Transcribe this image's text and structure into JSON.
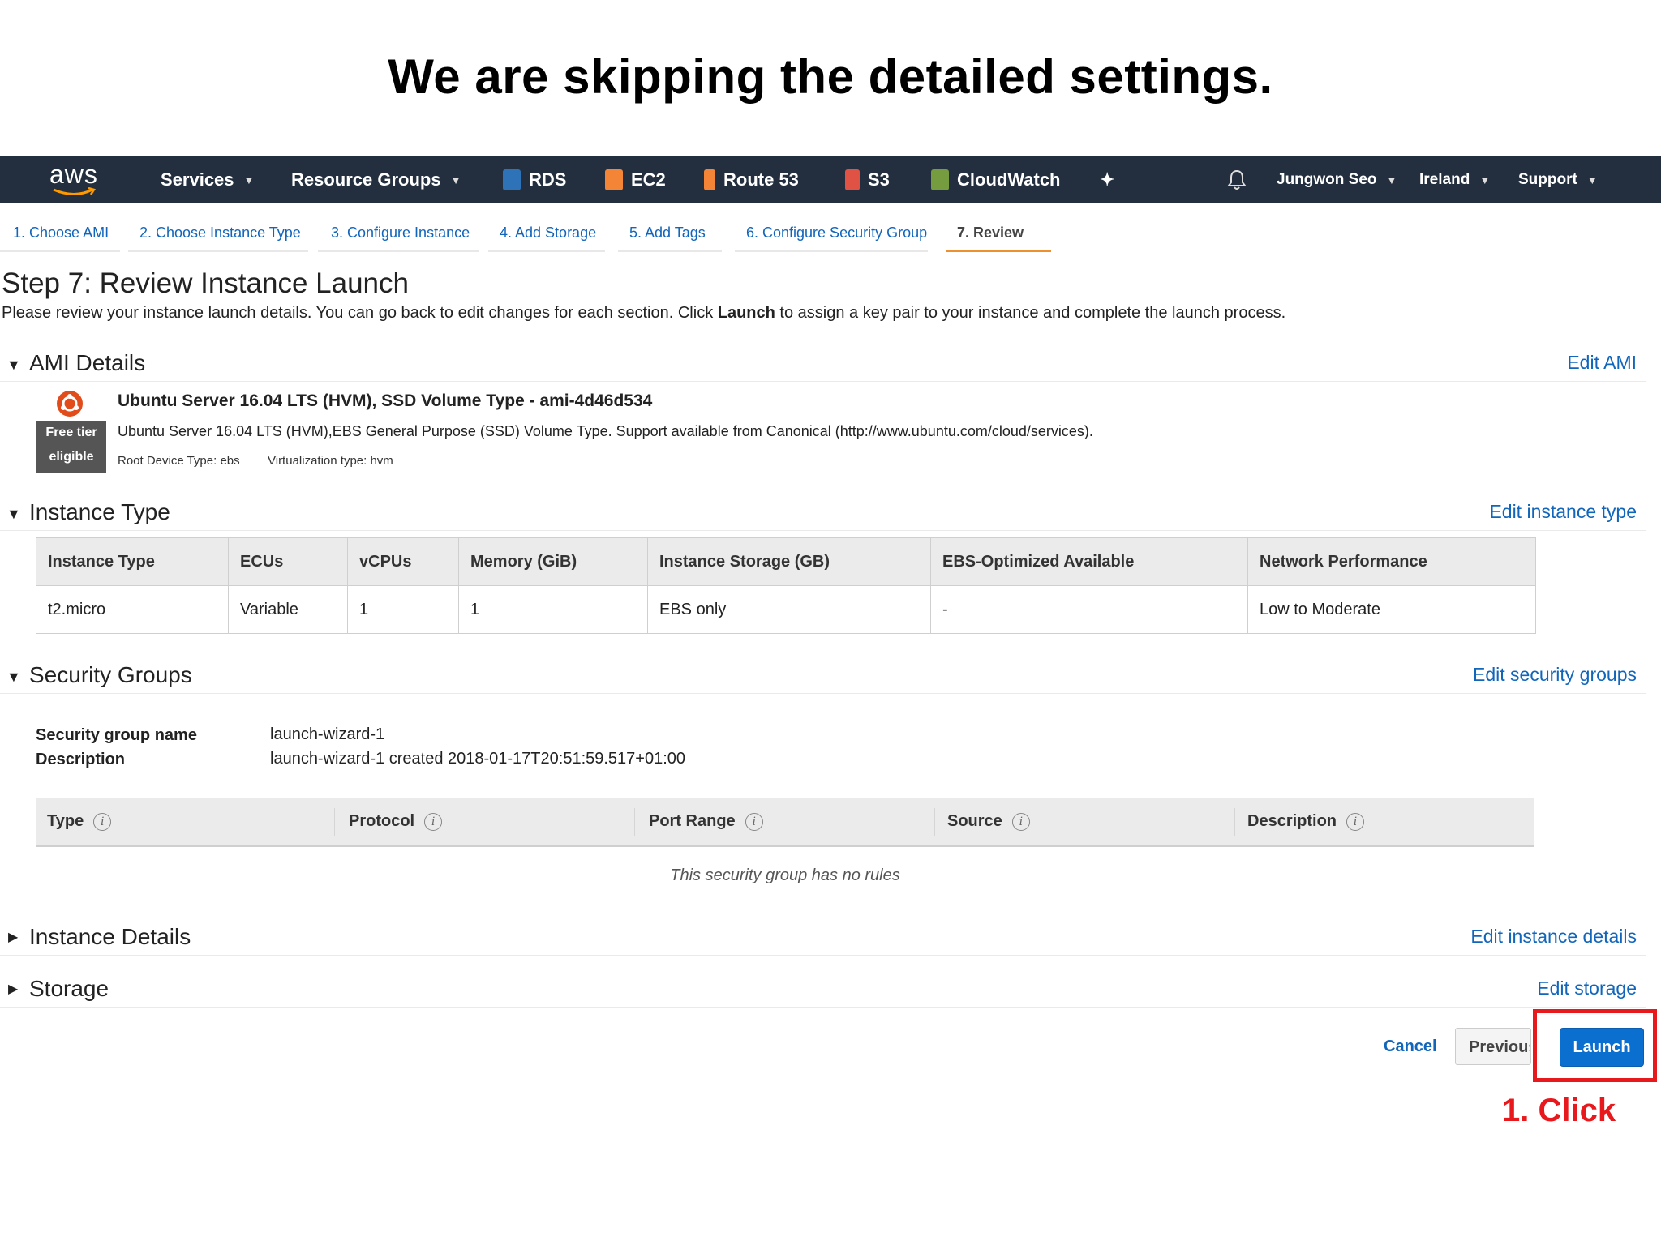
{
  "slide_title": "We are skipping the detailed settings.",
  "topnav": {
    "logo": "aws",
    "items": [
      {
        "label": "Services"
      },
      {
        "label": "Resource Groups"
      },
      {
        "label": "RDS"
      },
      {
        "label": "EC2"
      },
      {
        "label": "Route 53"
      },
      {
        "label": "S3"
      },
      {
        "label": "CloudWatch"
      }
    ],
    "user": "Jungwon Seo",
    "region": "Ireland",
    "support": "Support",
    "colors": {
      "bar": "#232f3e",
      "rds": "#2e73b8",
      "ec2": "#f58536",
      "route53": "#f58536",
      "s3": "#e05243",
      "cloudwatch": "#759c3e"
    }
  },
  "steps": [
    "1. Choose AMI",
    "2. Choose Instance Type",
    "3. Configure Instance",
    "4. Add Storage",
    "5. Add Tags",
    "6. Configure Security Group",
    "7. Review"
  ],
  "page": {
    "title": "Step 7: Review Instance Launch",
    "desc_before": "Please review your instance launch details. You can go back to edit changes for each section. Click ",
    "desc_bold": "Launch",
    "desc_after": " to assign a key pair to your instance and complete the launch process."
  },
  "ami": {
    "section": "AMI Details",
    "edit": "Edit AMI",
    "name": "Ubuntu Server 16.04 LTS (HVM), SSD Volume Type - ami-4d46d534",
    "description": "Ubuntu Server 16.04 LTS (HVM),EBS General Purpose (SSD) Volume Type. Support available from Canonical (http://www.ubuntu.com/cloud/services).",
    "root_device": "Root Device Type: ebs",
    "virtualization": "Virtualization type: hvm",
    "free_tier_line1": "Free tier",
    "free_tier_line2": "eligible"
  },
  "instance_type": {
    "section": "Instance Type",
    "edit": "Edit instance type",
    "headers": [
      "Instance Type",
      "ECUs",
      "vCPUs",
      "Memory (GiB)",
      "Instance Storage (GB)",
      "EBS-Optimized Available",
      "Network Performance"
    ],
    "row": [
      "t2.micro",
      "Variable",
      "1",
      "1",
      "EBS only",
      "-",
      "Low to Moderate"
    ]
  },
  "security_groups": {
    "section": "Security Groups",
    "edit": "Edit security groups",
    "name_label": "Security group name",
    "name_value": "launch-wizard-1",
    "desc_label": "Description",
    "desc_value": "launch-wizard-1 created 2018-01-17T20:51:59.517+01:00",
    "rule_headers": [
      "Type",
      "Protocol",
      "Port Range",
      "Source",
      "Description"
    ],
    "no_rules": "This security group has no rules"
  },
  "instance_details": {
    "section": "Instance Details",
    "edit": "Edit instance details"
  },
  "storage": {
    "section": "Storage",
    "edit": "Edit storage"
  },
  "buttons": {
    "cancel": "Cancel",
    "previous": "Previous",
    "launch": "Launch"
  },
  "annotation": {
    "callout": "1. Click",
    "color": "#e8191d"
  }
}
